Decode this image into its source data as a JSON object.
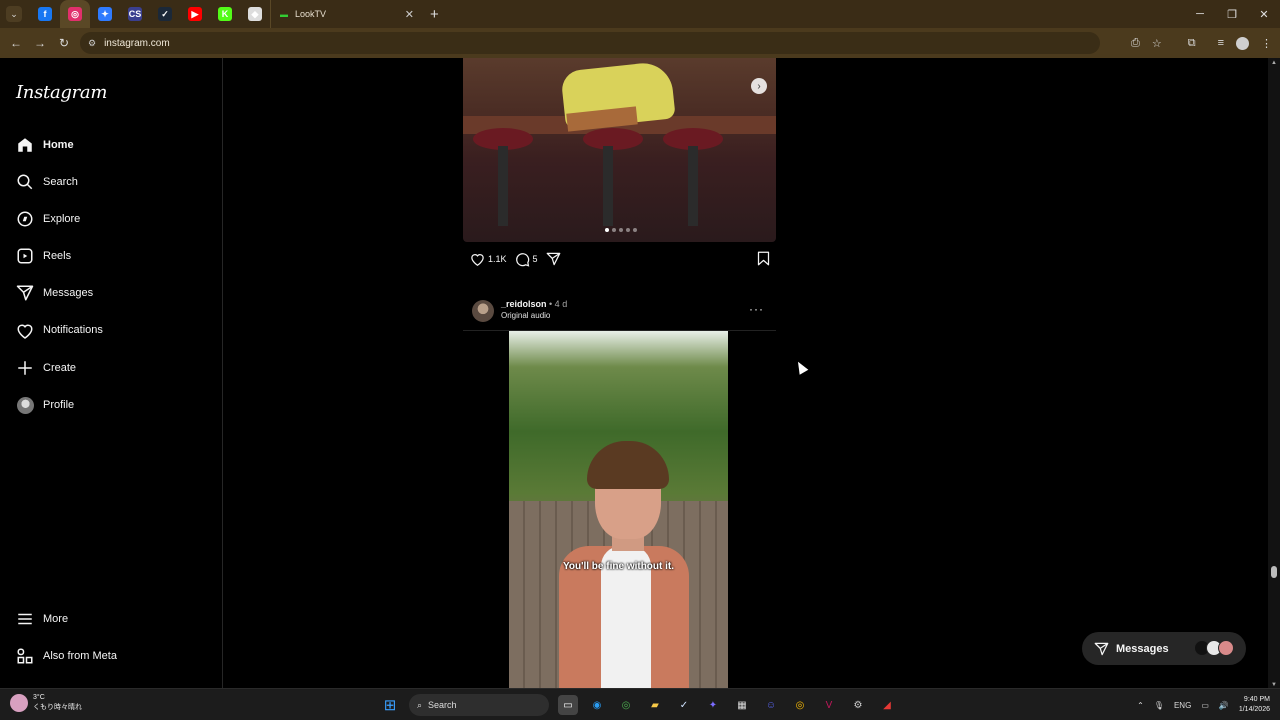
{
  "browser": {
    "tab_title": "LookTV",
    "url": "instagram.com",
    "pinned_tabs": [
      {
        "icon": "facebook-icon",
        "color": "#1877f2",
        "glyph": "f"
      },
      {
        "icon": "instagram-icon",
        "color": "#e1306c",
        "glyph": "◎",
        "active": true
      },
      {
        "icon": "messenger-icon",
        "color": "#2f7bff",
        "glyph": "✦"
      },
      {
        "icon": "cs-icon",
        "color": "#3a3f8f",
        "glyph": "CS"
      },
      {
        "icon": "steam-icon",
        "color": "#1b2838",
        "glyph": "✓"
      },
      {
        "icon": "youtube-icon",
        "color": "#ff0000",
        "glyph": "▶"
      },
      {
        "icon": "kick-icon",
        "color": "#53fc18",
        "glyph": "K"
      },
      {
        "icon": "diamond-icon",
        "color": "#dddddd",
        "glyph": "◆"
      }
    ]
  },
  "instagram": {
    "logo": "Instagram",
    "nav": [
      {
        "label": "Home",
        "icon": "home-icon",
        "bold": true
      },
      {
        "label": "Search",
        "icon": "search-icon"
      },
      {
        "label": "Explore",
        "icon": "compass-icon"
      },
      {
        "label": "Reels",
        "icon": "reels-icon"
      },
      {
        "label": "Messages",
        "icon": "send-icon"
      },
      {
        "label": "Notifications",
        "icon": "heart-icon"
      },
      {
        "label": "Create",
        "icon": "plus-icon"
      },
      {
        "label": "Profile",
        "icon": "avatar-icon"
      }
    ],
    "bottom_nav": [
      {
        "label": "More",
        "icon": "menu-icon"
      },
      {
        "label": "Also from Meta",
        "icon": "meta-icon"
      }
    ],
    "post1": {
      "likes": "1.1K",
      "comments": "5",
      "carousel_count": 5,
      "carousel_active": 0
    },
    "post2": {
      "username": "_reidolson",
      "time": "• 4 d",
      "audio": "Original audio",
      "caption": "You'll be fine without it."
    },
    "messages_pill": {
      "label": "Messages"
    }
  },
  "taskbar": {
    "temperature": "3°C",
    "weather_text": "くもり時々晴れ",
    "search_label": "Search",
    "language": "ENG",
    "time": "9:40 PM",
    "date": "1/14/2026"
  }
}
